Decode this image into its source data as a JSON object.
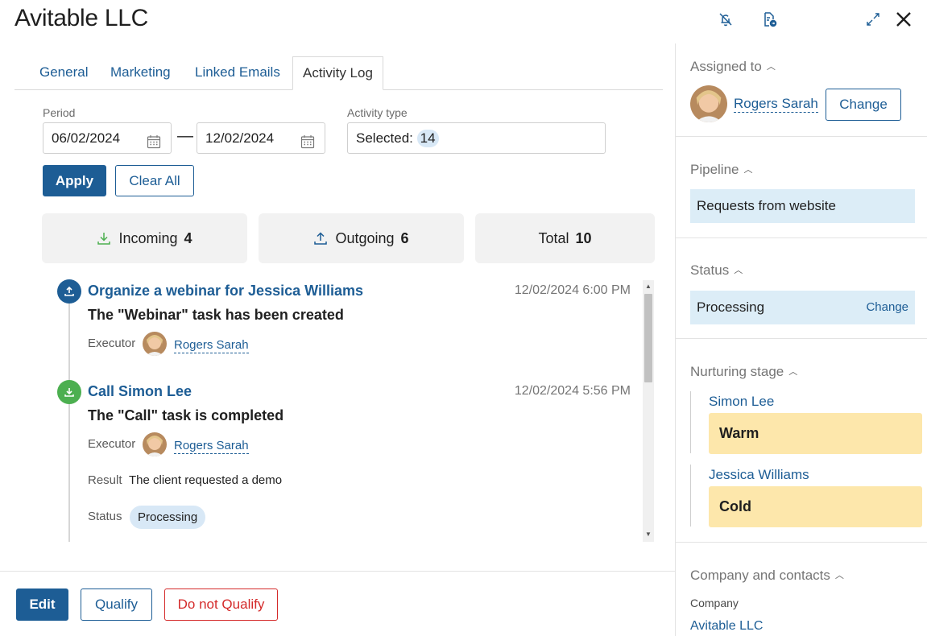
{
  "title": "Avitable LLC",
  "tabs": [
    {
      "label": "General"
    },
    {
      "label": "Marketing"
    },
    {
      "label": "Linked Emails"
    },
    {
      "label": "Activity Log"
    }
  ],
  "filters": {
    "period_label": "Period",
    "date_from": "06/02/2024",
    "date_to": "12/02/2024",
    "activity_type_label": "Activity type",
    "activity_type_prefix": "Selected:",
    "activity_type_count": "14",
    "apply_label": "Apply",
    "clear_label": "Clear All"
  },
  "stats": {
    "incoming_label": "Incoming",
    "incoming_count": "4",
    "outgoing_label": "Outgoing",
    "outgoing_count": "6",
    "total_label": "Total",
    "total_count": "10"
  },
  "activities": [
    {
      "direction": "outgoing",
      "title": "Organize a webinar for Jessica Williams",
      "time": "12/02/2024 6:00 PM",
      "description": "The \"Webinar\" task has been created",
      "executor_label": "Executor",
      "executor": "Rogers Sarah"
    },
    {
      "direction": "incoming",
      "title": "Call Simon Lee",
      "time": "12/02/2024 5:56 PM",
      "description": "The \"Call\" task is completed",
      "executor_label": "Executor",
      "executor": "Rogers Sarah",
      "result_label": "Result",
      "result": "The client requested a demo",
      "status_label": "Status",
      "status": "Processing"
    }
  ],
  "footer": {
    "edit_label": "Edit",
    "qualify_label": "Qualify",
    "not_qualify_label": "Do not Qualify"
  },
  "sidebar": {
    "assigned_title": "Assigned to",
    "assigned_user": "Rogers Sarah",
    "assigned_change": "Change",
    "pipeline_title": "Pipeline",
    "pipeline_value": "Requests from website",
    "status_title": "Status",
    "status_value": "Processing",
    "status_change": "Change",
    "nurturing_title": "Nurturing stage",
    "nurturing": [
      {
        "name": "Simon Lee",
        "stage": "Warm"
      },
      {
        "name": "Jessica Williams",
        "stage": "Cold"
      }
    ],
    "company_title": "Company and contacts",
    "company_label": "Company",
    "company_name": "Avitable LLC"
  },
  "colors": {
    "accent": "#1d5d95",
    "incoming": "#4caf50",
    "danger": "#d42a2a",
    "stage_bg": "#fde7ab",
    "info_bg": "#dcedf7"
  },
  "icons": [
    "bell-off-icon",
    "document-export-icon",
    "expand-icon",
    "close-icon",
    "calendar-icon",
    "download-icon",
    "upload-icon",
    "chevron-up-icon"
  ]
}
